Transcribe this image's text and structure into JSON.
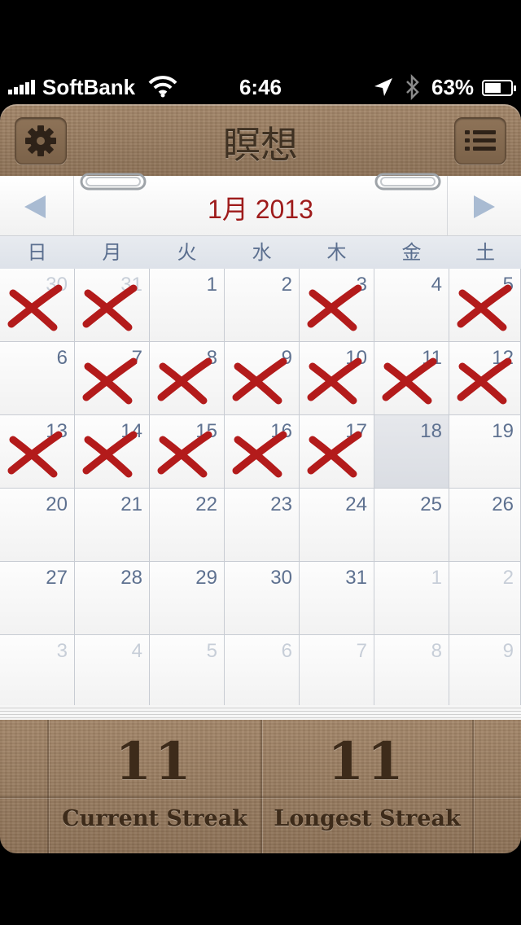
{
  "status_bar": {
    "carrier": "SoftBank",
    "time": "6:46",
    "battery": "63%",
    "battery_level": 0.63,
    "icons": [
      "signal-icon",
      "wifi-icon",
      "location-icon",
      "bluetooth-icon",
      "battery-icon"
    ]
  },
  "header": {
    "title": "瞑想",
    "settings_icon": "gear-icon",
    "list_icon": "list-icon"
  },
  "calendar": {
    "month_title": "1月 2013",
    "prev_icon": "left-triangle-icon",
    "next_icon": "right-triangle-icon",
    "weekdays": [
      "日",
      "月",
      "火",
      "水",
      "木",
      "金",
      "土"
    ],
    "mark_color": "#b31b1b",
    "days": [
      {
        "n": "30",
        "other": true,
        "marked": true
      },
      {
        "n": "31",
        "other": true,
        "marked": true
      },
      {
        "n": "1",
        "marked": false
      },
      {
        "n": "2",
        "marked": false
      },
      {
        "n": "3",
        "marked": true
      },
      {
        "n": "4",
        "marked": false
      },
      {
        "n": "5",
        "marked": true
      },
      {
        "n": "6",
        "marked": false
      },
      {
        "n": "7",
        "marked": true
      },
      {
        "n": "8",
        "marked": true
      },
      {
        "n": "9",
        "marked": true
      },
      {
        "n": "10",
        "marked": true
      },
      {
        "n": "11",
        "marked": true
      },
      {
        "n": "12",
        "marked": true
      },
      {
        "n": "13",
        "marked": true
      },
      {
        "n": "14",
        "marked": true
      },
      {
        "n": "15",
        "marked": true
      },
      {
        "n": "16",
        "marked": true
      },
      {
        "n": "17",
        "marked": true
      },
      {
        "n": "18",
        "today": true,
        "marked": false
      },
      {
        "n": "19",
        "marked": false
      },
      {
        "n": "20",
        "marked": false
      },
      {
        "n": "21",
        "marked": false
      },
      {
        "n": "22",
        "marked": false
      },
      {
        "n": "23",
        "marked": false
      },
      {
        "n": "24",
        "marked": false
      },
      {
        "n": "25",
        "marked": false
      },
      {
        "n": "26",
        "marked": false
      },
      {
        "n": "27",
        "marked": false
      },
      {
        "n": "28",
        "marked": false
      },
      {
        "n": "29",
        "marked": false
      },
      {
        "n": "30",
        "marked": false
      },
      {
        "n": "31",
        "marked": false
      },
      {
        "n": "1",
        "other": true,
        "marked": false
      },
      {
        "n": "2",
        "other": true,
        "marked": false
      },
      {
        "n": "3",
        "other": true,
        "marked": false
      },
      {
        "n": "4",
        "other": true,
        "marked": false
      },
      {
        "n": "5",
        "other": true,
        "marked": false
      },
      {
        "n": "6",
        "other": true,
        "marked": false
      },
      {
        "n": "7",
        "other": true,
        "marked": false
      },
      {
        "n": "8",
        "other": true,
        "marked": false
      },
      {
        "n": "9",
        "other": true,
        "marked": false
      }
    ]
  },
  "footer": {
    "current_streak": {
      "value": "11",
      "label": "Current Streak"
    },
    "longest_streak": {
      "value": "11",
      "label": "Longest Streak"
    }
  }
}
